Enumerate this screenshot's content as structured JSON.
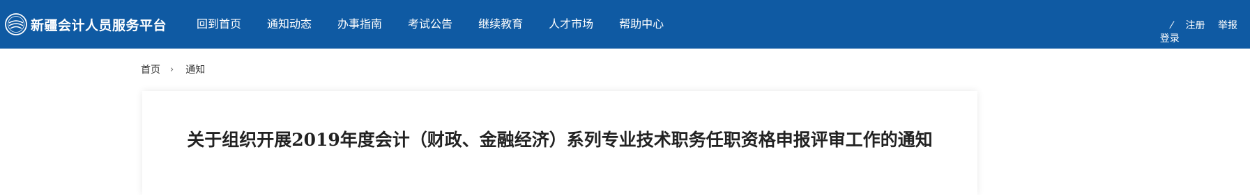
{
  "header": {
    "logo_text": "新疆会计人员服务平台",
    "logo_icon": "seal-logo-icon",
    "bg_color": "#0f5aa3"
  },
  "nav": [
    {
      "label": "回到首页"
    },
    {
      "label": "通知动态"
    },
    {
      "label": "办事指南"
    },
    {
      "label": "考试公告"
    },
    {
      "label": "继续教育"
    },
    {
      "label": "人才市场"
    },
    {
      "label": "帮助中心"
    }
  ],
  "account": {
    "separator": "⁄",
    "register": "注册",
    "report": "举报",
    "login": "登录"
  },
  "breadcrumb": {
    "home": "首页",
    "separator": "›",
    "current": "通知"
  },
  "article": {
    "title": "关于组织开展2019年度会计（财政、金融经济）系列专业技术职务任职资格申报评审工作的通知"
  }
}
